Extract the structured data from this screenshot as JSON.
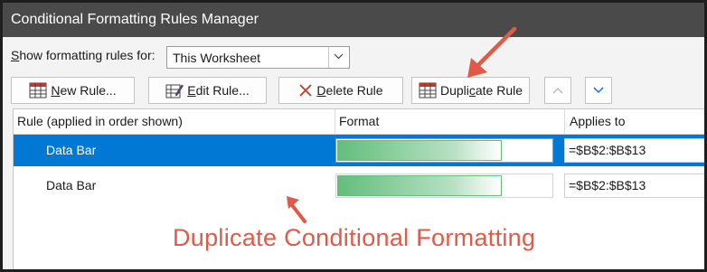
{
  "dialog": {
    "title": "Conditional Formatting Rules Manager"
  },
  "filter": {
    "label_prefix": "S",
    "label_rest": "how formatting rules for:",
    "selected": "This Worksheet"
  },
  "toolbar": {
    "new_rule": {
      "key": "N",
      "rest": "ew Rule..."
    },
    "edit_rule": {
      "key": "E",
      "rest": "dit Rule..."
    },
    "delete_rule": {
      "key": "D",
      "rest": "elete Rule"
    },
    "duplicate_rule": {
      "pre": "Dupli",
      "key": "c",
      "rest": "ate Rule"
    }
  },
  "table": {
    "columns": [
      "Rule (applied in order shown)",
      "Format",
      "Applies to"
    ],
    "rows": [
      {
        "rule": "Data Bar",
        "applies_to": "=$B$2:$B$13",
        "selected": true
      },
      {
        "rule": "Data Bar",
        "applies_to": "=$B$2:$B$13",
        "selected": false
      }
    ]
  },
  "annotation": {
    "text": "Duplicate Conditional Formatting",
    "color": "#e05a47"
  },
  "colors": {
    "selection": "#0078d4",
    "databar": "#63be7b",
    "titlebar": "#4a4a4a"
  }
}
